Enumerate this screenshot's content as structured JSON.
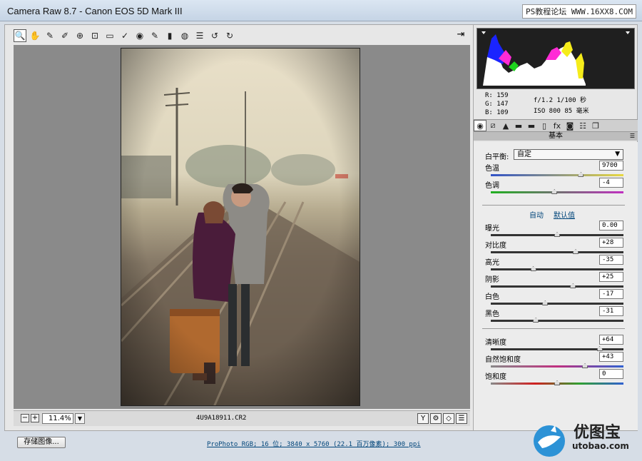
{
  "window": {
    "title": "Camera Raw 8.7 -  Canon EOS 5D Mark III",
    "watermark": "PS教程论坛 WWW.16XX8.COM"
  },
  "toolbar": {
    "tools": [
      {
        "name": "zoom-icon",
        "glyph": "🔍",
        "active": true
      },
      {
        "name": "hand-icon",
        "glyph": "✋"
      },
      {
        "name": "white-balance-icon",
        "glyph": "✎"
      },
      {
        "name": "color-sampler-icon",
        "glyph": "✐"
      },
      {
        "name": "targeted-adjust-icon",
        "glyph": "⊕"
      },
      {
        "name": "crop-icon",
        "glyph": "⊡"
      },
      {
        "name": "straighten-icon",
        "glyph": "▭"
      },
      {
        "name": "spot-removal-icon",
        "glyph": "✓"
      },
      {
        "name": "red-eye-icon",
        "glyph": "◉"
      },
      {
        "name": "adjustment-brush-icon",
        "glyph": "✎"
      },
      {
        "name": "graduated-filter-icon",
        "glyph": "▮"
      },
      {
        "name": "radial-filter-icon",
        "glyph": "◍"
      },
      {
        "name": "preferences-icon",
        "glyph": "☰"
      },
      {
        "name": "rotate-left-icon",
        "glyph": "↺"
      },
      {
        "name": "rotate-right-icon",
        "glyph": "↻"
      }
    ],
    "open_object_glyph": "⇥"
  },
  "preview": {
    "zoom": "11.4%",
    "filename": "4U9A18911.CR2"
  },
  "readout": {
    "r": "R:  159",
    "g": "G:  147",
    "b": "B:  109",
    "exposure": "f/1.2  1/100 秒",
    "iso": "ISO 800   85 毫米"
  },
  "panel": {
    "tabs": [
      "◉",
      "⧄",
      "▲",
      "▬",
      "▬",
      "▯",
      "fx",
      "◙",
      "☷",
      "❐"
    ],
    "title": "基本",
    "wb_label": "白平衡:",
    "wb_value": "自定",
    "auto": "自动",
    "default": "默认值"
  },
  "sliders": [
    {
      "name": "temperature",
      "label": "色温",
      "value": "9700",
      "pos": 0.68,
      "gradient": "linear-gradient(90deg,#3052c8,#e8d840)"
    },
    {
      "name": "tint",
      "label": "色调",
      "value": "-4",
      "pos": 0.48,
      "gradient": "linear-gradient(90deg,#20b020,#c030c0)"
    },
    {
      "name": "exposure",
      "label": "曝光",
      "value": "0.00",
      "pos": 0.5
    },
    {
      "name": "contrast",
      "label": "对比度",
      "value": "+28",
      "pos": 0.64
    },
    {
      "name": "highlights",
      "label": "高光",
      "value": "-35",
      "pos": 0.32
    },
    {
      "name": "shadows",
      "label": "阴影",
      "value": "+25",
      "pos": 0.62
    },
    {
      "name": "whites",
      "label": "白色",
      "value": "-17",
      "pos": 0.41
    },
    {
      "name": "blacks",
      "label": "黑色",
      "value": "-31",
      "pos": 0.34
    },
    {
      "name": "clarity",
      "label": "清晰度",
      "value": "+64",
      "pos": 0.82
    },
    {
      "name": "vibrance",
      "label": "自然饱和度",
      "value": "+43",
      "pos": 0.71,
      "gradient": "linear-gradient(90deg,#888,#c03080,#3060d0)"
    },
    {
      "name": "saturation",
      "label": "饱和度",
      "value": "0",
      "pos": 0.5,
      "gradient": "linear-gradient(90deg,#888,#d02020,#30a030,#3060d0)"
    }
  ],
  "bottom": {
    "save": "存储图像...",
    "workflow": "ProPhoto RGB; 16 位; 3840 x 5760 (22.1 百万像素); 300 ppi",
    "brand": "优图宝",
    "brand_url": "utobao.com"
  }
}
